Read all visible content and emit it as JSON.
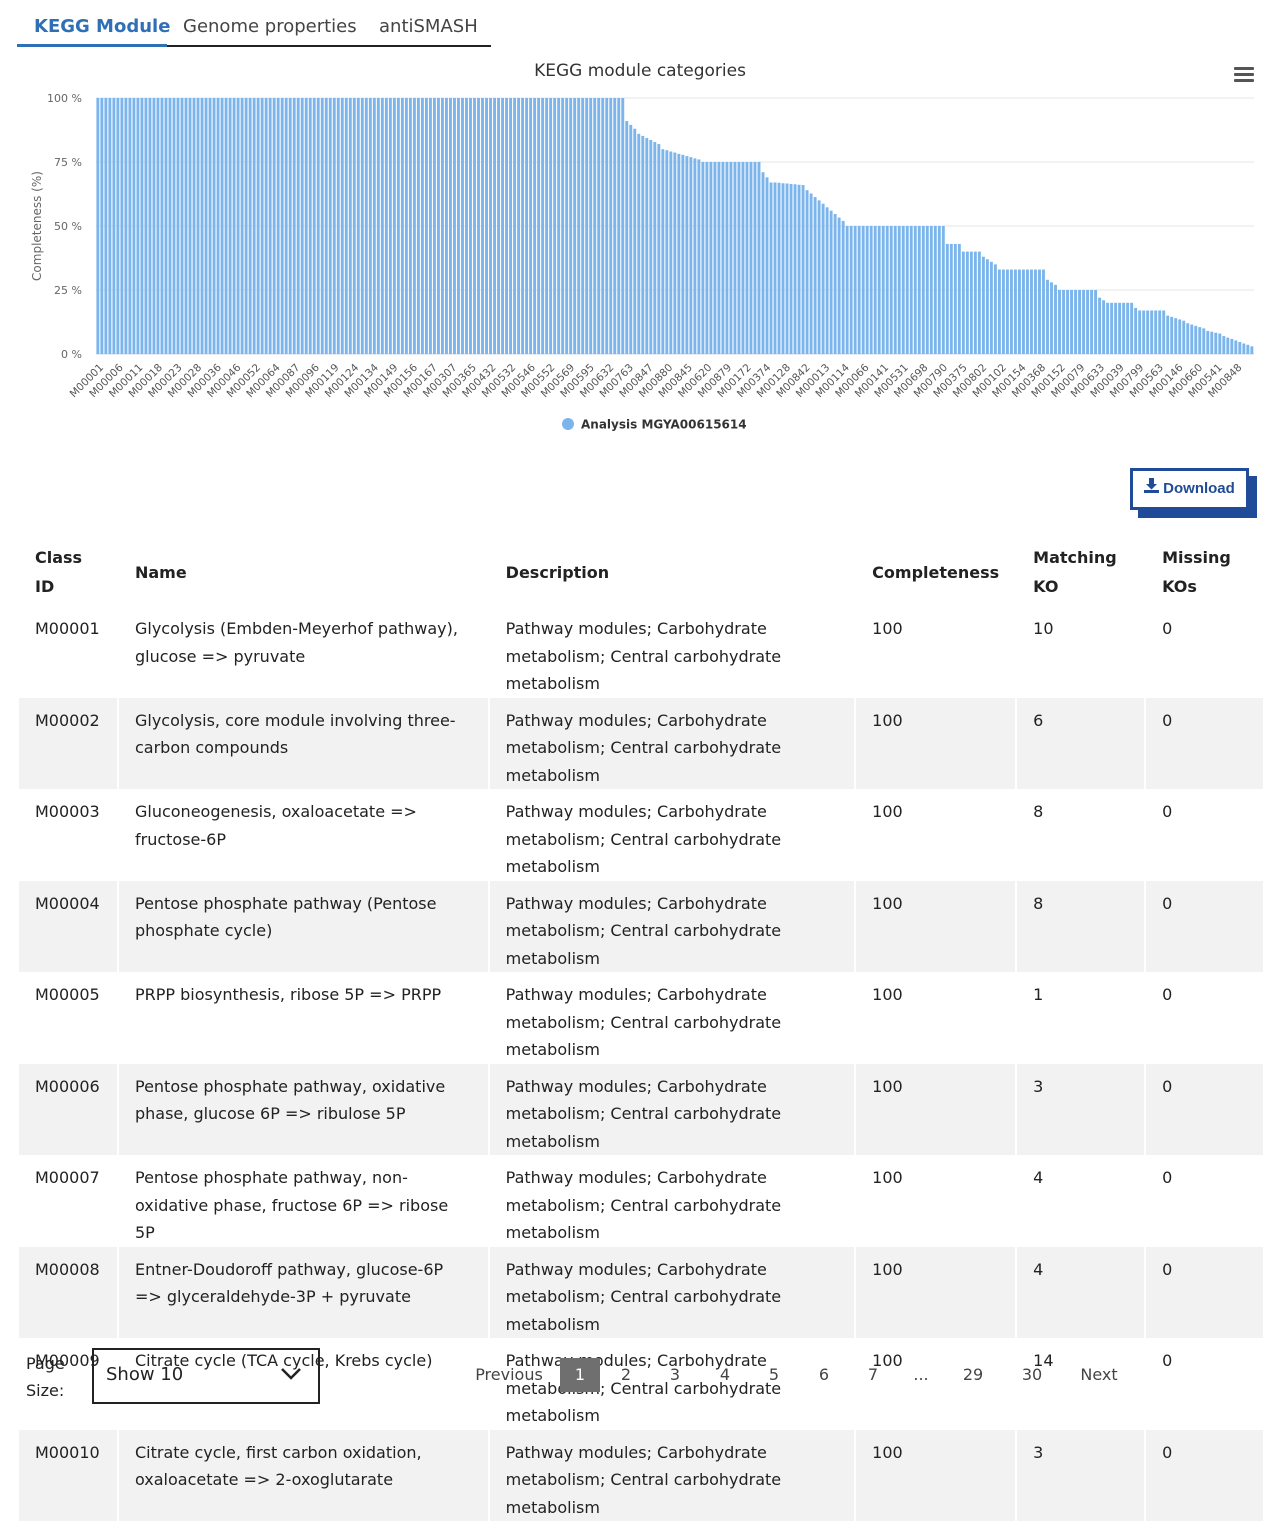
{
  "tabs": [
    {
      "label": "KEGG Module",
      "active": true
    },
    {
      "label": "Genome properties",
      "active": false
    },
    {
      "label": "antiSMASH",
      "active": false
    }
  ],
  "chart_data": {
    "type": "bar",
    "title": "KEGG module categories",
    "ylabel": "Completeness (%)",
    "ylim": [
      0,
      100
    ],
    "yticks": [
      "0 %",
      "25 %",
      "50 %",
      "75 %",
      "100 %"
    ],
    "legend": "bottom-center",
    "series": [
      {
        "name": "Analysis MGYA00615614",
        "color": "#7cb5ec"
      }
    ],
    "segments": [
      {
        "count": 132,
        "from": 100,
        "to": 100
      },
      {
        "count": 3,
        "from": 91,
        "to": 88
      },
      {
        "count": 6,
        "from": 86,
        "to": 82
      },
      {
        "count": 10,
        "from": 80,
        "to": 76
      },
      {
        "count": 15,
        "from": 75,
        "to": 75
      },
      {
        "count": 3,
        "from": 71,
        "to": 67
      },
      {
        "count": 8,
        "from": 67,
        "to": 66
      },
      {
        "count": 10,
        "from": 64,
        "to": 52
      },
      {
        "count": 25,
        "from": 50,
        "to": 50
      },
      {
        "count": 4,
        "from": 43,
        "to": 43
      },
      {
        "count": 5,
        "from": 40,
        "to": 40
      },
      {
        "count": 4,
        "from": 38,
        "to": 35
      },
      {
        "count": 12,
        "from": 33,
        "to": 33
      },
      {
        "count": 3,
        "from": 29,
        "to": 27
      },
      {
        "count": 10,
        "from": 25,
        "to": 25
      },
      {
        "count": 3,
        "from": 22,
        "to": 20
      },
      {
        "count": 6,
        "from": 20,
        "to": 20
      },
      {
        "count": 2,
        "from": 18,
        "to": 17
      },
      {
        "count": 6,
        "from": 17,
        "to": 17
      },
      {
        "count": 5,
        "from": 15,
        "to": 13
      },
      {
        "count": 5,
        "from": 12,
        "to": 10
      },
      {
        "count": 4,
        "from": 9,
        "to": 8
      },
      {
        "count": 8,
        "from": 7,
        "to": 3
      }
    ],
    "x_tick_labels": [
      "M00001",
      "M00006",
      "M00011",
      "M00018",
      "M00023",
      "M00028",
      "M00036",
      "M00046",
      "M00052",
      "M00064",
      "M00087",
      "M00096",
      "M00119",
      "M00124",
      "M00134",
      "M00149",
      "M00156",
      "M00167",
      "M00307",
      "M00365",
      "M00432",
      "M00532",
      "M00546",
      "M00552",
      "M00569",
      "M00595",
      "M00632",
      "M00763",
      "M00847",
      "M00880",
      "M00845",
      "M00620",
      "M00879",
      "M00172",
      "M00374",
      "M00128",
      "M00842",
      "M00013",
      "M00114",
      "M00066",
      "M00141",
      "M00531",
      "M00698",
      "M00790",
      "M00375",
      "M00802",
      "M00102",
      "M00154",
      "M00368",
      "M00152",
      "M00079",
      "M00633",
      "M00039",
      "M00799",
      "M00563",
      "M00146",
      "M00660",
      "M00541",
      "M00848"
    ]
  },
  "download": {
    "label": "Download"
  },
  "table": {
    "headers": [
      {
        "line1": "Class",
        "line2": "ID"
      },
      {
        "line1": "Name",
        "line2": ""
      },
      {
        "line1": "Description",
        "line2": ""
      },
      {
        "line1": "Completeness",
        "line2": ""
      },
      {
        "line1": "Matching",
        "line2": "KO"
      },
      {
        "line1": "Missing",
        "line2": "KOs"
      }
    ],
    "rows": [
      {
        "id": "M00001",
        "name": "Glycolysis (Embden-Meyerhof pathway), glucose => pyruvate",
        "desc": "Pathway modules; Carbohydrate metabolism; Central carbohydrate metabolism",
        "completeness": "100",
        "matching": "10",
        "missing": "0"
      },
      {
        "id": "M00002",
        "name": "Glycolysis, core module involving three-carbon compounds",
        "desc": "Pathway modules; Carbohydrate metabolism; Central carbohydrate metabolism",
        "completeness": "100",
        "matching": "6",
        "missing": "0"
      },
      {
        "id": "M00003",
        "name": "Gluconeogenesis, oxaloacetate => fructose-6P",
        "desc": "Pathway modules; Carbohydrate metabolism; Central carbohydrate metabolism",
        "completeness": "100",
        "matching": "8",
        "missing": "0"
      },
      {
        "id": "M00004",
        "name": "Pentose phosphate pathway (Pentose phosphate cycle)",
        "desc": "Pathway modules; Carbohydrate metabolism; Central carbohydrate metabolism",
        "completeness": "100",
        "matching": "8",
        "missing": "0"
      },
      {
        "id": "M00005",
        "name": "PRPP biosynthesis, ribose 5P => PRPP",
        "desc": "Pathway modules; Carbohydrate metabolism; Central carbohydrate metabolism",
        "completeness": "100",
        "matching": "1",
        "missing": "0"
      },
      {
        "id": "M00006",
        "name": "Pentose phosphate pathway, oxidative phase, glucose 6P => ribulose 5P",
        "desc": "Pathway modules; Carbohydrate metabolism; Central carbohydrate metabolism",
        "completeness": "100",
        "matching": "3",
        "missing": "0"
      },
      {
        "id": "M00007",
        "name": "Pentose phosphate pathway, non-oxidative phase, fructose 6P => ribose 5P",
        "desc": "Pathway modules; Carbohydrate metabolism; Central carbohydrate metabolism",
        "completeness": "100",
        "matching": "4",
        "missing": "0"
      },
      {
        "id": "M00008",
        "name": "Entner-Doudoroff pathway, glucose-6P => glyceraldehyde-3P + pyruvate",
        "desc": "Pathway modules; Carbohydrate metabolism; Central carbohydrate metabolism",
        "completeness": "100",
        "matching": "4",
        "missing": "0"
      },
      {
        "id": "M00009",
        "name": "Citrate cycle (TCA cycle, Krebs cycle)",
        "desc": "Pathway modules; Carbohydrate metabolism; Central carbohydrate metabolism",
        "completeness": "100",
        "matching": "14",
        "missing": "0"
      },
      {
        "id": "M00010",
        "name": "Citrate cycle, first carbon oxidation, oxaloacetate => 2-oxoglutarate",
        "desc": "Pathway modules; Carbohydrate metabolism; Central carbohydrate metabolism",
        "completeness": "100",
        "matching": "3",
        "missing": "0"
      }
    ]
  },
  "pagination": {
    "page_size_label": "Page Size:",
    "page_size_value": "Show 10",
    "previous": "Previous",
    "next": "Next",
    "pages": [
      "1",
      "2",
      "3",
      "4",
      "5",
      "6",
      "7",
      "...",
      "29",
      "30"
    ],
    "current": "1"
  }
}
